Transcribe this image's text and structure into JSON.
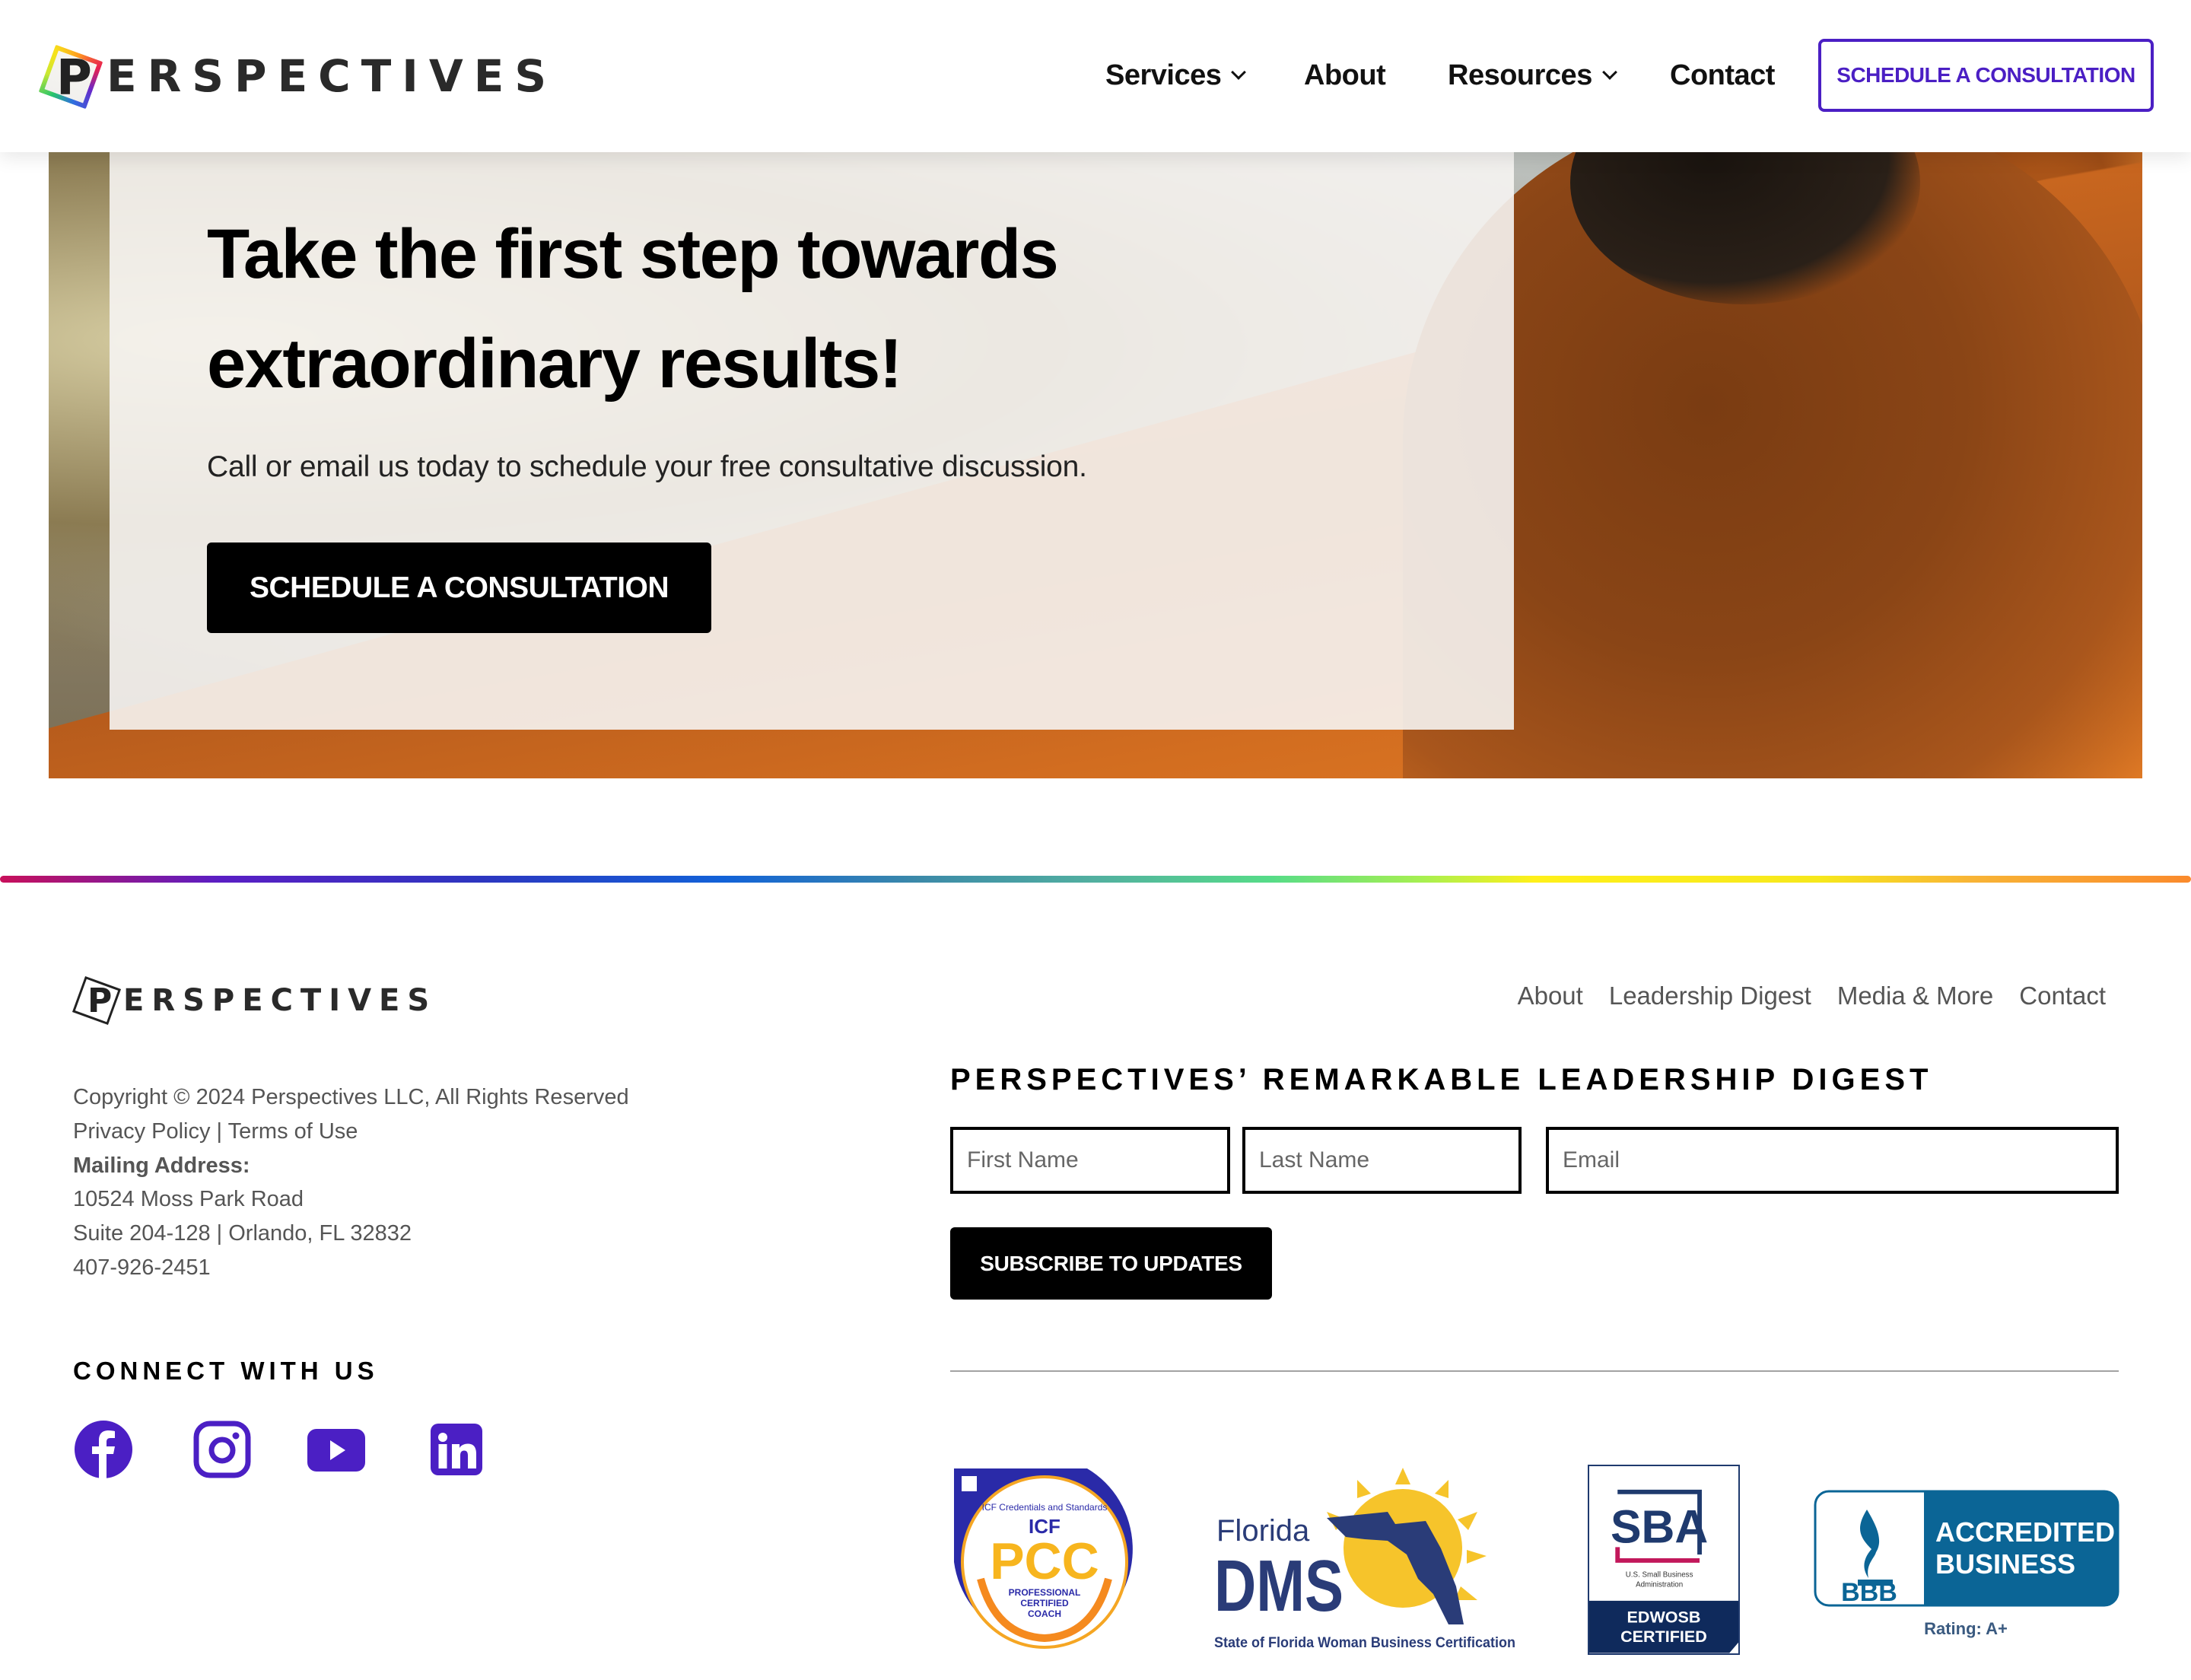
{
  "header": {
    "logo_letter": "P",
    "logo_text": "ERSPECTIVES",
    "nav": [
      {
        "label": "Services",
        "has_dropdown": true
      },
      {
        "label": "About",
        "has_dropdown": false
      },
      {
        "label": "Resources",
        "has_dropdown": true
      },
      {
        "label": "Contact",
        "has_dropdown": false
      }
    ],
    "cta_label": "SCHEDULE A CONSULTATION",
    "cta_color": "#4b1fc4"
  },
  "hero": {
    "title_line1": "Take the first step towards",
    "title_line2": "extraordinary results!",
    "subtitle": "Call or email us today to schedule your free consultative discussion.",
    "button_label": "SCHEDULE A CONSULTATION"
  },
  "footer": {
    "logo_letter": "P",
    "logo_text": "ERSPECTIVES",
    "links": [
      "About",
      "Leadership Digest",
      "Media & More",
      "Contact"
    ],
    "copyright": "Copyright © 2024 Perspectives  LLC, All Rights Reserved",
    "privacy_label": "Privacy Policy",
    "separator": " | ",
    "terms_label": "Terms of Use",
    "mailing_label": "Mailing Address:",
    "address_line1": "10524 Moss Park Road",
    "address_line2": "Suite 204-128 | Orlando, FL 32832",
    "phone": "407-926-2451",
    "connect_heading": "CONNECT WITH US",
    "social": [
      {
        "name": "facebook",
        "icon": "facebook-icon"
      },
      {
        "name": "instagram",
        "icon": "instagram-icon"
      },
      {
        "name": "youtube",
        "icon": "youtube-icon"
      },
      {
        "name": "linkedin",
        "icon": "linkedin-icon"
      }
    ],
    "social_color": "#4b1fc4",
    "digest_heading": "PERSPECTIVES’ REMARKABLE LEADERSHIP DIGEST",
    "form": {
      "first_name_placeholder": "First Name",
      "last_name_placeholder": "Last Name",
      "email_placeholder": "Email",
      "first_name_value": "",
      "last_name_value": "",
      "email_value": "",
      "submit_label": "SUBSCRIBE TO UPDATES"
    },
    "badges": {
      "pcc": {
        "arc_text": "ICF Credentials and Standards",
        "org": "ICF",
        "code": "PCC",
        "line1": "PROFESSIONAL",
        "line2": "CERTIFIED",
        "line3": "COACH"
      },
      "dms": {
        "state": "Florida",
        "org": "DMS",
        "caption": "State of Florida Woman Business Certification"
      },
      "sba": {
        "org": "SBA",
        "line1": "U.S. Small Business",
        "line2": "Administration",
        "cert1": "EDWOSB",
        "cert2": "CERTIFIED"
      },
      "bbb": {
        "org": "BBB",
        "line1": "ACCREDITED",
        "line2": "BUSINESS",
        "rating": "Rating: A+"
      }
    }
  }
}
